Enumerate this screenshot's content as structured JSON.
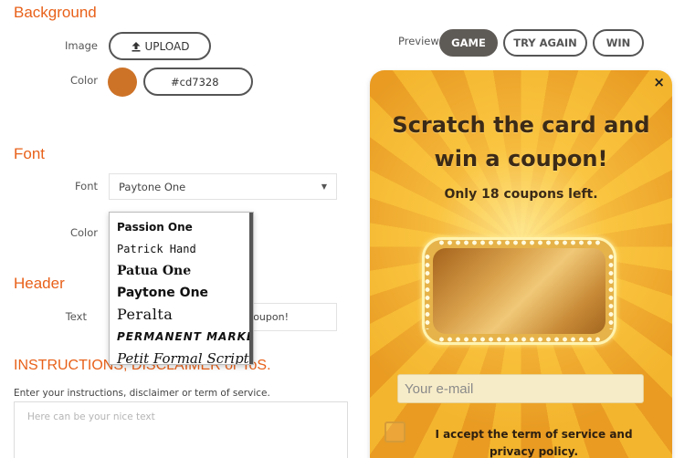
{
  "settings": {
    "background": {
      "title": "Background",
      "image_label": "Image",
      "upload_label": "UPLOAD",
      "color_label": "Color",
      "color_value": "#cd7328",
      "swatch_color": "#cd7328"
    },
    "font": {
      "title": "Font",
      "font_label": "Font",
      "font_value": "Paytone One",
      "color_label": "Color",
      "dropdown_options": [
        "Passion One",
        "Patrick Hand",
        "Patua One",
        "Paytone One",
        "Peralta",
        "Permanent Marker",
        "Petit Formal Script"
      ]
    },
    "header": {
      "title": "Header",
      "text_label": "Text",
      "text_value_visible": "coupon!"
    },
    "instructions": {
      "title": "INSTRUCTIONS, DISCLAIMER or ToS.",
      "description": "Enter your instructions, disclaimer or term of service.",
      "placeholder": "Here can be your nice text"
    }
  },
  "preview": {
    "label": "Preview",
    "tabs": [
      "GAME",
      "TRY AGAIN",
      "WIN"
    ],
    "active_tab": "GAME",
    "card": {
      "close": "×",
      "title": "Scratch the card and win a coupon!",
      "subtitle": "Only 18 coupons left.",
      "email_placeholder": "Your e-mail",
      "terms": "I accept the term of service and privacy policy."
    }
  },
  "icons": {
    "upload": "upload-icon",
    "close": "close-icon",
    "caret": "chevron-down-icon"
  }
}
